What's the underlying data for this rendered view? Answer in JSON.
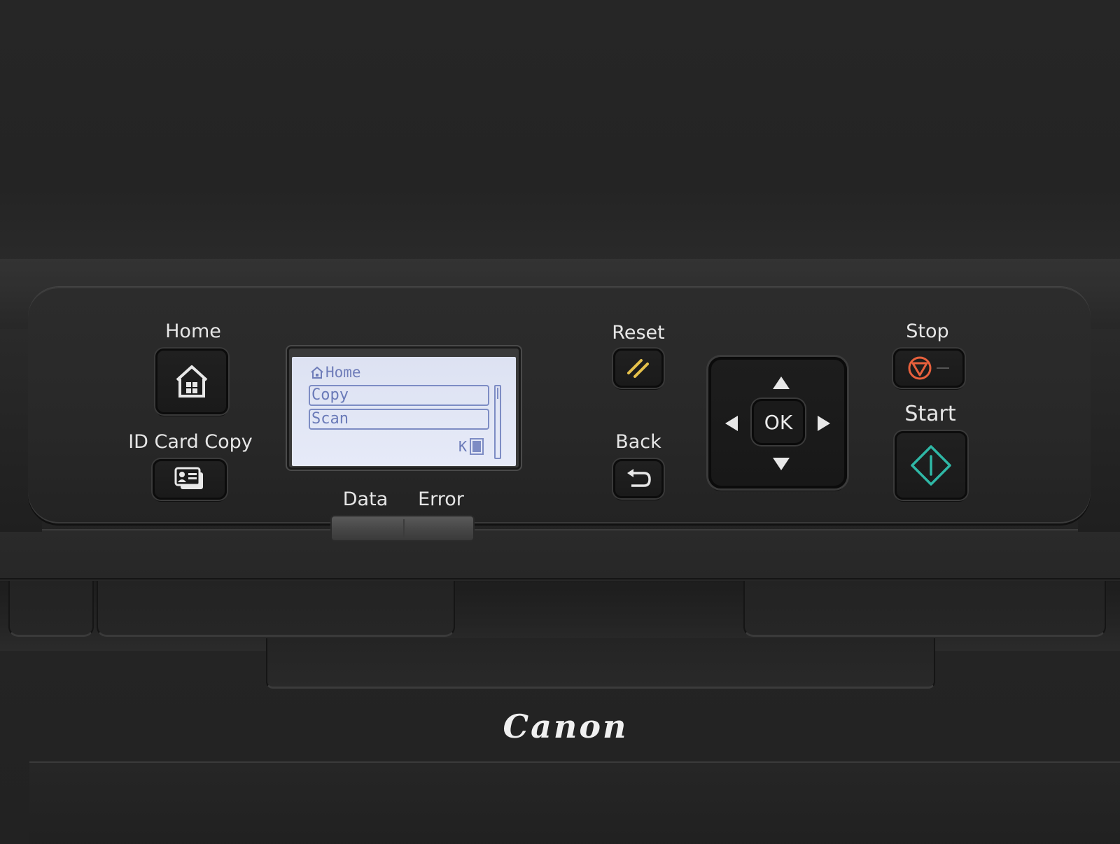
{
  "brand": "Canon",
  "buttons": {
    "home_label": "Home",
    "id_card_copy_label": "ID Card Copy",
    "reset_label": "Reset",
    "back_label": "Back",
    "stop_label": "Stop",
    "start_label": "Start",
    "ok_label": "OK"
  },
  "indicators": {
    "data_label": "Data",
    "error_label": "Error"
  },
  "lcd": {
    "title": "Home",
    "items": [
      "Copy",
      "Scan"
    ],
    "toner_label": "K"
  },
  "icons": {
    "home": "house-icon",
    "id_card_copy": "id-card-icon",
    "reset": "reset-slash-icon",
    "back": "back-arrow-icon",
    "stop": "stop-icon",
    "start": "start-diamond-icon"
  },
  "colors": {
    "stop_accent": "#e8603c",
    "start_accent": "#2fb8a6",
    "reset_accent": "#e7c24b",
    "lcd_text": "#6a7ab8",
    "lcd_background": "#e2e7f6"
  }
}
